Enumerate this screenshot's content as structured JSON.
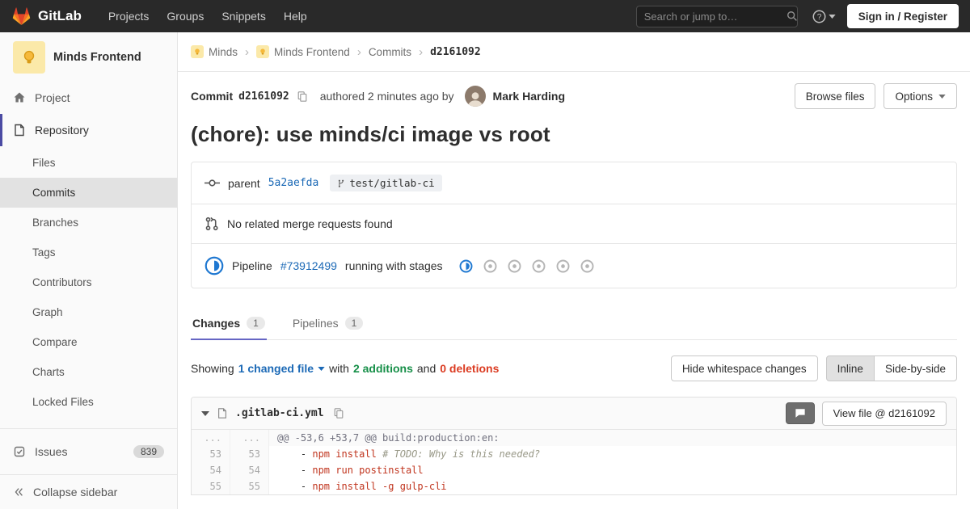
{
  "navbar": {
    "brand": "GitLab",
    "items": [
      "Projects",
      "Groups",
      "Snippets",
      "Help"
    ],
    "search_placeholder": "Search or jump to…",
    "sign_in_label": "Sign in / Register"
  },
  "sidebar": {
    "project_name": "Minds Frontend",
    "project_item": "Project",
    "repository": {
      "label": "Repository",
      "items": [
        "Files",
        "Commits",
        "Branches",
        "Tags",
        "Contributors",
        "Graph",
        "Compare",
        "Charts",
        "Locked Files"
      ],
      "active_item": "Commits"
    },
    "issues_label": "Issues",
    "issues_count": "839",
    "collapse_label": "Collapse sidebar"
  },
  "breadcrumb": {
    "items": [
      "Minds",
      "Minds Frontend",
      "Commits"
    ],
    "current": "d2161092"
  },
  "commit": {
    "label": "Commit",
    "sha": "d2161092",
    "authored": "authored 2 minutes ago by",
    "author": "Mark Harding",
    "browse_files": "Browse files",
    "options": "Options",
    "title": "(chore): use minds/ci image vs root",
    "parent_label": "parent",
    "parent_sha": "5a2aefda",
    "branch": "test/gitlab-ci",
    "mr_text": "No related merge requests found",
    "pipeline": {
      "label": "Pipeline",
      "id": "#73912499",
      "status_text": "running with stages",
      "stages": [
        "running",
        "created",
        "created",
        "created",
        "created",
        "created"
      ]
    }
  },
  "tabs": {
    "changes": "Changes",
    "changes_count": "1",
    "pipelines": "Pipelines",
    "pipelines_count": "1"
  },
  "summary": {
    "showing": "Showing",
    "changed_file": "1 changed file",
    "with": "with",
    "additions": "2 additions",
    "and": "and",
    "deletions": "0 deletions",
    "hide_whitespace": "Hide whitespace changes",
    "inline": "Inline",
    "side_by_side": "Side-by-side"
  },
  "diff": {
    "file_name": ".gitlab-ci.yml",
    "view_file": "View file @ d2161092",
    "hunk": {
      "old": "...",
      "new": "...",
      "text": "@@ -53,6 +53,7 @@ build:production:en:"
    },
    "lines": [
      {
        "old": "53",
        "new": "53",
        "prefix": "    - ",
        "text": "npm install ",
        "comment": "# TODO: Why is this needed?"
      },
      {
        "old": "54",
        "new": "54",
        "prefix": "    - ",
        "text": "npm run postinstall",
        "comment": ""
      },
      {
        "old": "55",
        "new": "55",
        "prefix": "    - ",
        "text": "npm install -g gulp-cli",
        "comment": ""
      }
    ]
  },
  "colors": {
    "accent": "#6666c4",
    "link": "#1b69b6",
    "added": "#168f48",
    "removed": "#db3b21",
    "running": "#1f78d1",
    "brand_orange": "#e24329"
  }
}
